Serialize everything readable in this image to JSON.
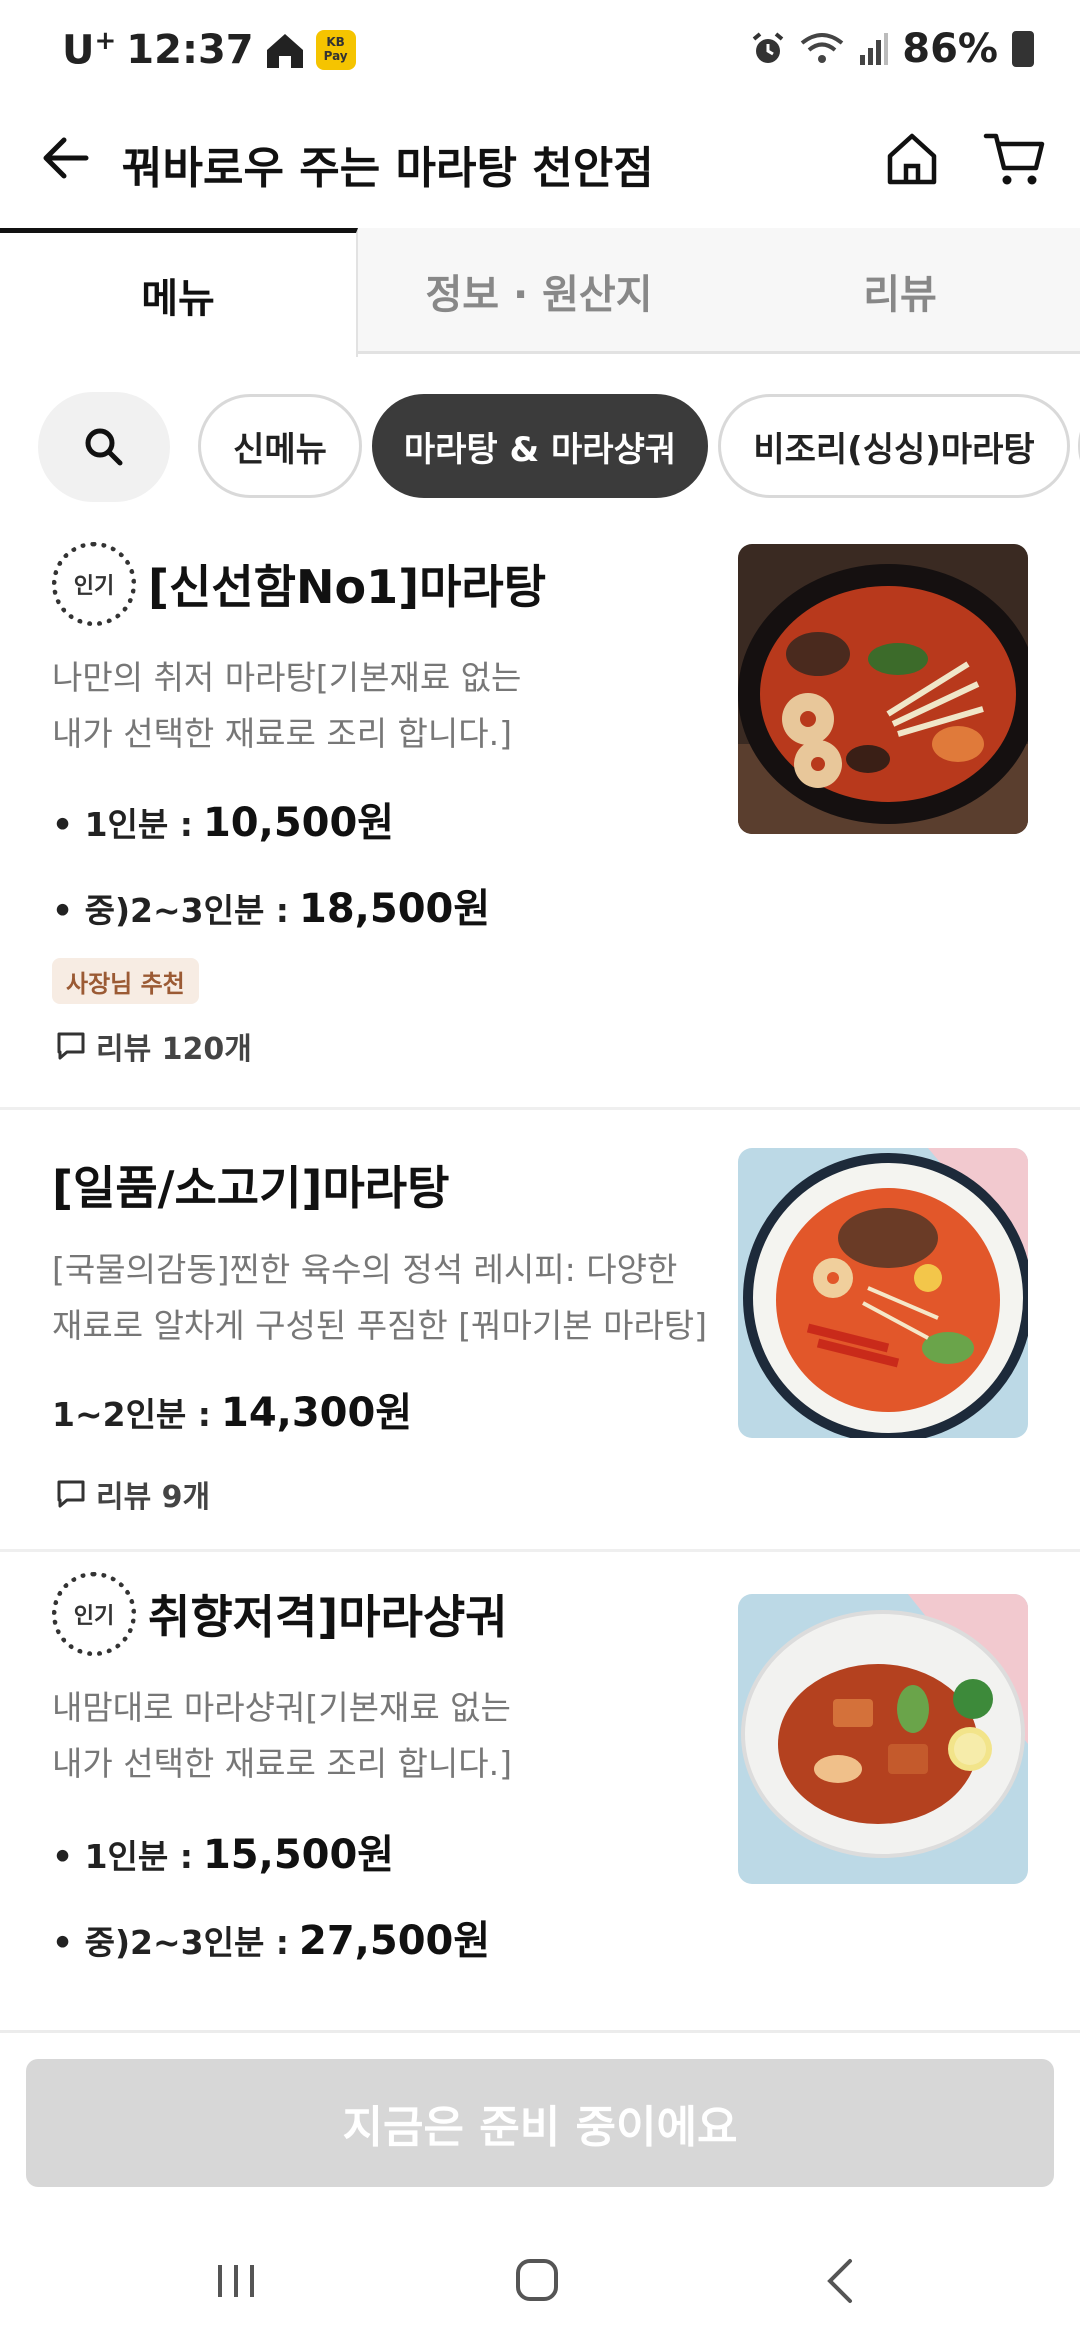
{
  "status_bar": {
    "carrier": "U",
    "carrier_sup": "+",
    "time": "12:37",
    "pay_badge": "KB Pay",
    "battery": "86%"
  },
  "header": {
    "title": "꿔바로우 주는 마라탕 천안점"
  },
  "tabs": [
    {
      "label": "메뉴",
      "active": true
    },
    {
      "label": "정보 · 원산지",
      "active": false
    },
    {
      "label": "리뷰",
      "active": false
    }
  ],
  "chips": [
    {
      "label": "신메뉴",
      "active": false
    },
    {
      "label": "마라탕 & 마라샹궈",
      "active": true
    },
    {
      "label": "비조리(싱싱)마라탕",
      "active": false
    }
  ],
  "menu": [
    {
      "popular_badge": "인기",
      "name": "[신선함No1]마라탕",
      "desc_line1": "나만의 취저 마라탕[기본재료 없는",
      "desc_line2": "내가 선택한 재료로 조리 합니다.]",
      "prices": [
        {
          "label": "• 1인분 :",
          "value": "10,500원"
        },
        {
          "label": "• 중)2~3인분 :",
          "value": "18,500원"
        }
      ],
      "badge": "사장님 추천",
      "review": "리뷰 120개"
    },
    {
      "name": "[일품/소고기]마라탕",
      "desc_line1": "[국물의감동]찐한 육수의 정석 레시피: 다양한",
      "desc_line2": "재료로 알차게 구성된 푸짐한 [꿔마기본 마라탕]",
      "prices": [
        {
          "label": "1~2인분 :",
          "value": "14,300원"
        }
      ],
      "review": "리뷰 9개"
    },
    {
      "popular_badge": "인기",
      "name": "취향저격]마라샹궈",
      "desc_line1": "내맘대로 마라샹궈[기본재료 없는",
      "desc_line2": "내가 선택한 재료로 조리 합니다.]",
      "prices": [
        {
          "label": "• 1인분 :",
          "value": "15,500원"
        },
        {
          "label": "• 중)2~3인분 :",
          "value": "27,500원"
        }
      ]
    }
  ],
  "bottom": {
    "order_button": "지금은 준비 중이에요"
  },
  "colors": {
    "active_chip": "#3b3b3b",
    "badge_bg": "#f7ece3",
    "badge_text": "#9b5a34",
    "disabled_button": "#d7d7d7"
  },
  "icons": [
    "home-icon",
    "pay-icon",
    "alarm-icon",
    "wifi-icon",
    "signal-icon",
    "battery-icon",
    "back-arrow-icon",
    "home-icon",
    "cart-icon",
    "search-icon",
    "comment-icon",
    "nav-recent-icon",
    "nav-home-icon",
    "nav-back-icon"
  ]
}
